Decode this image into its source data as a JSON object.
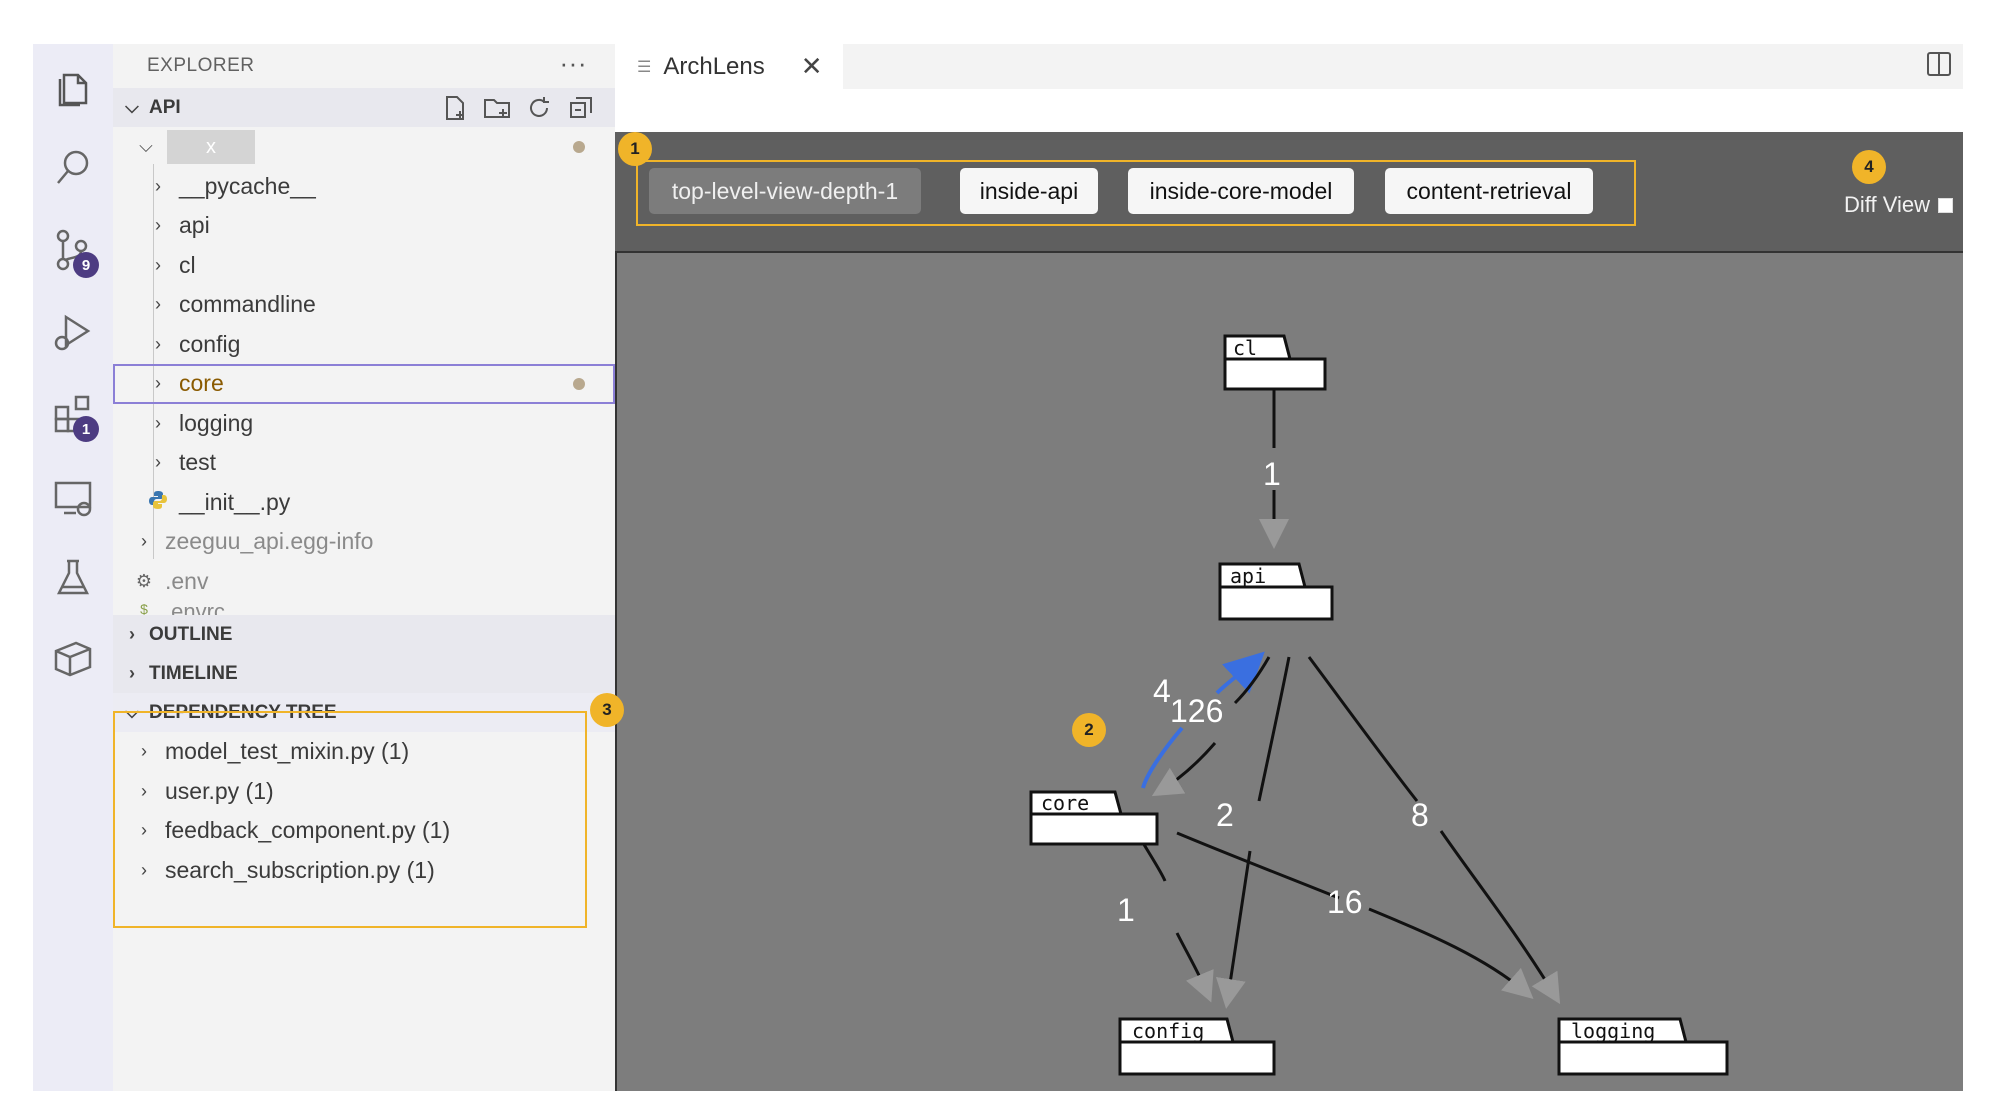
{
  "sidebar": {
    "title": "EXPLORER",
    "more_glyph": "···",
    "api_section": "API",
    "root_folder": "x",
    "tree": [
      {
        "label": "__pycache__",
        "type": "folder"
      },
      {
        "label": "api",
        "type": "folder"
      },
      {
        "label": "cl",
        "type": "folder"
      },
      {
        "label": "commandline",
        "type": "folder"
      },
      {
        "label": "config",
        "type": "folder"
      },
      {
        "label": "core",
        "type": "folder",
        "selected": true,
        "modified": true
      },
      {
        "label": "logging",
        "type": "folder"
      },
      {
        "label": "test",
        "type": "folder"
      },
      {
        "label": "__init__.py",
        "type": "python-file"
      }
    ],
    "egg_info": "zeeguu_api.egg-info",
    "env": ".env",
    "envrc": ".envrc",
    "outline": "OUTLINE",
    "timeline": "TIMELINE",
    "dependency_tree": "DEPENDENCY TREE",
    "dependencies": [
      "model_test_mixin.py (1)",
      "user.py (1)",
      "feedback_component.py (1)",
      "search_subscription.py (1)"
    ]
  },
  "activity": {
    "icons": [
      "files-icon",
      "search-icon",
      "source-control-icon",
      "run-debug-icon",
      "extensions-icon",
      "remote-explorer-icon",
      "testing-icon",
      "archlens-icon"
    ],
    "scm_badge": "9",
    "ext_badge": "1"
  },
  "editor": {
    "tab_title": "ArchLens",
    "tab_close": "✕",
    "views": [
      "top-level-view-depth-1",
      "inside-api",
      "inside-core-model",
      "content-retrieval"
    ],
    "active_view": "top-level-view-depth-1",
    "diff_view_label": "Diff View"
  },
  "callouts": [
    "1",
    "2",
    "3",
    "4"
  ],
  "graph": {
    "packages": [
      "cl",
      "api",
      "core",
      "config",
      "logging"
    ],
    "edges": [
      {
        "from": "cl",
        "to": "api",
        "label": "1"
      },
      {
        "from": "core",
        "to": "api",
        "label": "4",
        "highlighted": true
      },
      {
        "from": "api",
        "to": "core",
        "label": "126"
      },
      {
        "from": "api",
        "to": "config",
        "label": "2"
      },
      {
        "from": "api",
        "to": "logging",
        "label": "8"
      },
      {
        "from": "core",
        "to": "config",
        "label": "1"
      },
      {
        "from": "core",
        "to": "logging",
        "label": "16"
      }
    ],
    "colors": {
      "highlight": "#3a6fe0",
      "edge": "#111111",
      "background": "#7d7d7d",
      "callout": "#f0b429"
    }
  }
}
